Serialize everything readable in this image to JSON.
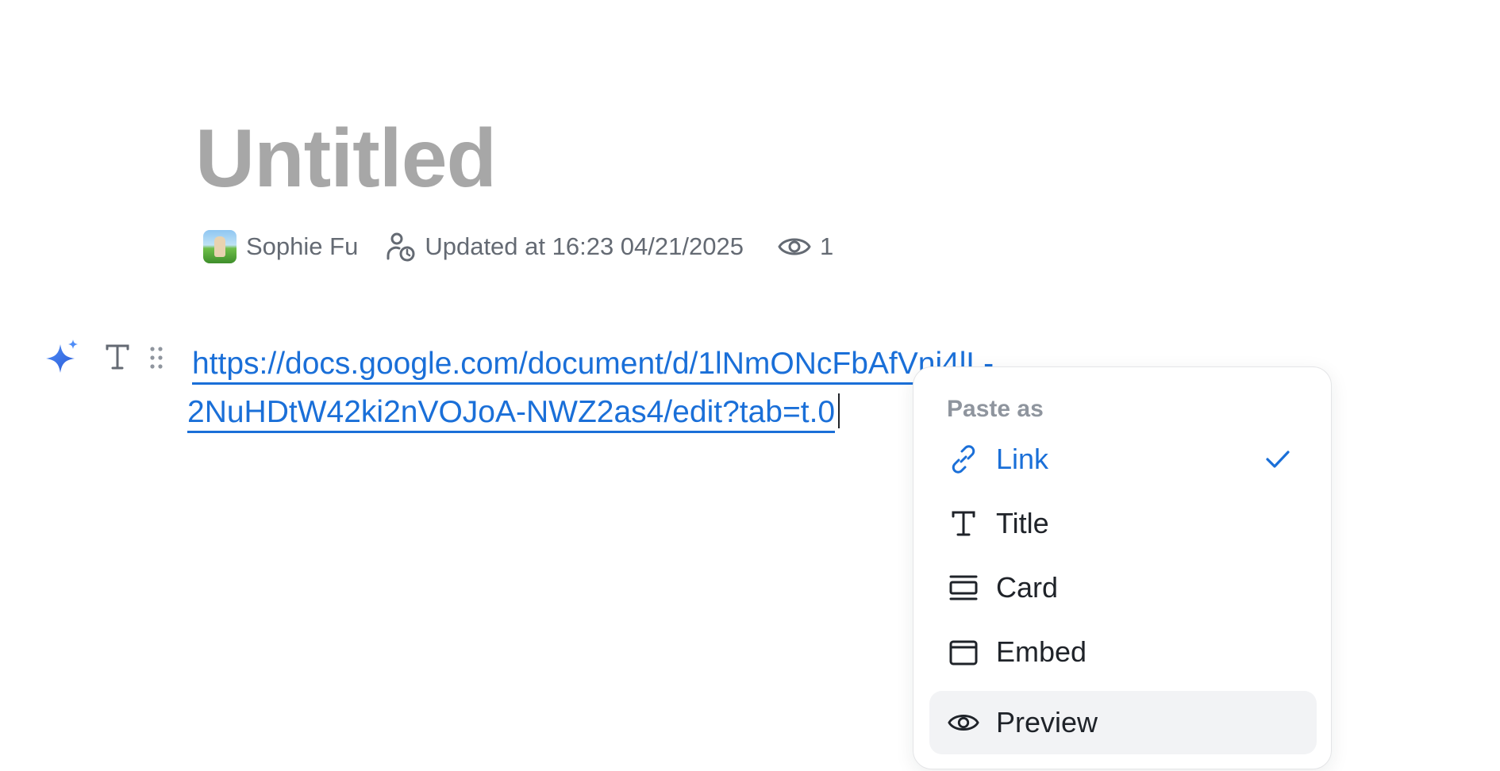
{
  "document": {
    "title": "Untitled"
  },
  "meta": {
    "author": "Sophie Fu",
    "updated": "Updated at 16:23 04/21/2025",
    "views": "1"
  },
  "content": {
    "link_line1": "https://docs.google.com/document/d/1lNmONcFbAfVni4lL-",
    "link_line2": "2NuHDtW42ki2nVOJoA-NWZ2as4/edit?tab=t.0"
  },
  "paste_menu": {
    "header": "Paste as",
    "items": [
      {
        "label": "Link",
        "icon": "link-icon",
        "selected": true
      },
      {
        "label": "Title",
        "icon": "text-t-icon"
      },
      {
        "label": "Card",
        "icon": "card-icon"
      },
      {
        "label": "Embed",
        "icon": "embed-icon"
      },
      {
        "label": "Preview",
        "icon": "eye-icon",
        "hovered": true
      }
    ]
  },
  "colors": {
    "accent": "#1a6fd8",
    "title_placeholder": "#a7a7a7",
    "muted": "#646a73",
    "hover_bg": "#f2f3f5"
  }
}
